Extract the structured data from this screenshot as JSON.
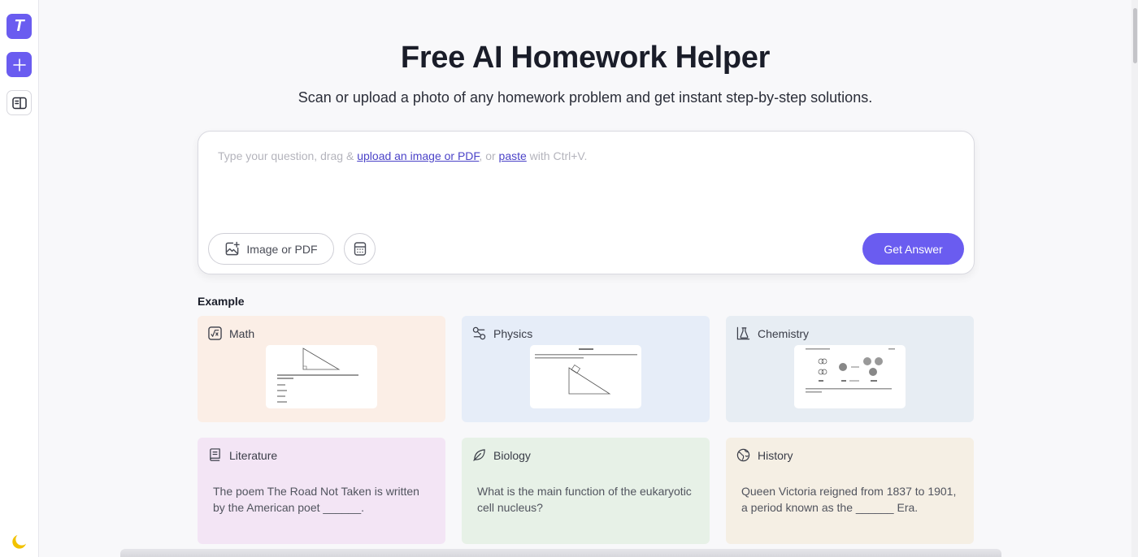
{
  "sidebar": {
    "logo_letter": "T"
  },
  "page": {
    "title": "Free AI Homework Helper",
    "subtitle": "Scan or upload a photo of any homework problem and get instant step-by-step solutions."
  },
  "input": {
    "placeholder_prefix": "Type your question, drag & ",
    "upload_link": "upload an image or PDF",
    "placeholder_middle": ", or ",
    "paste_link": "paste",
    "placeholder_suffix": " with Ctrl+V.",
    "upload_button": "Image or PDF",
    "submit_button": "Get Answer"
  },
  "examples": {
    "label": "Example",
    "cards": [
      {
        "subject": "Math",
        "icon": "square-root-icon",
        "color": "#fbeee6"
      },
      {
        "subject": "Physics",
        "icon": "atom-icon",
        "color": "#e6edf8"
      },
      {
        "subject": "Chemistry",
        "icon": "flask-icon",
        "color": "#e7edf3"
      },
      {
        "subject": "Literature",
        "icon": "book-icon",
        "color": "#f3e5f5",
        "text": "The poem The Road Not Taken is written by the American poet ______."
      },
      {
        "subject": "Biology",
        "icon": "leaf-icon",
        "color": "#e7f1e7",
        "text": "What is the main function of the eukaryotic cell nucleus?"
      },
      {
        "subject": "History",
        "icon": "globe-icon",
        "color": "#f5efe4",
        "text": "Queen Victoria reigned from 1837 to 1901, a period known as the ______ Era."
      }
    ]
  },
  "colors": {
    "accent": "#6a5cf0",
    "theme_icon": "#f2c200"
  }
}
